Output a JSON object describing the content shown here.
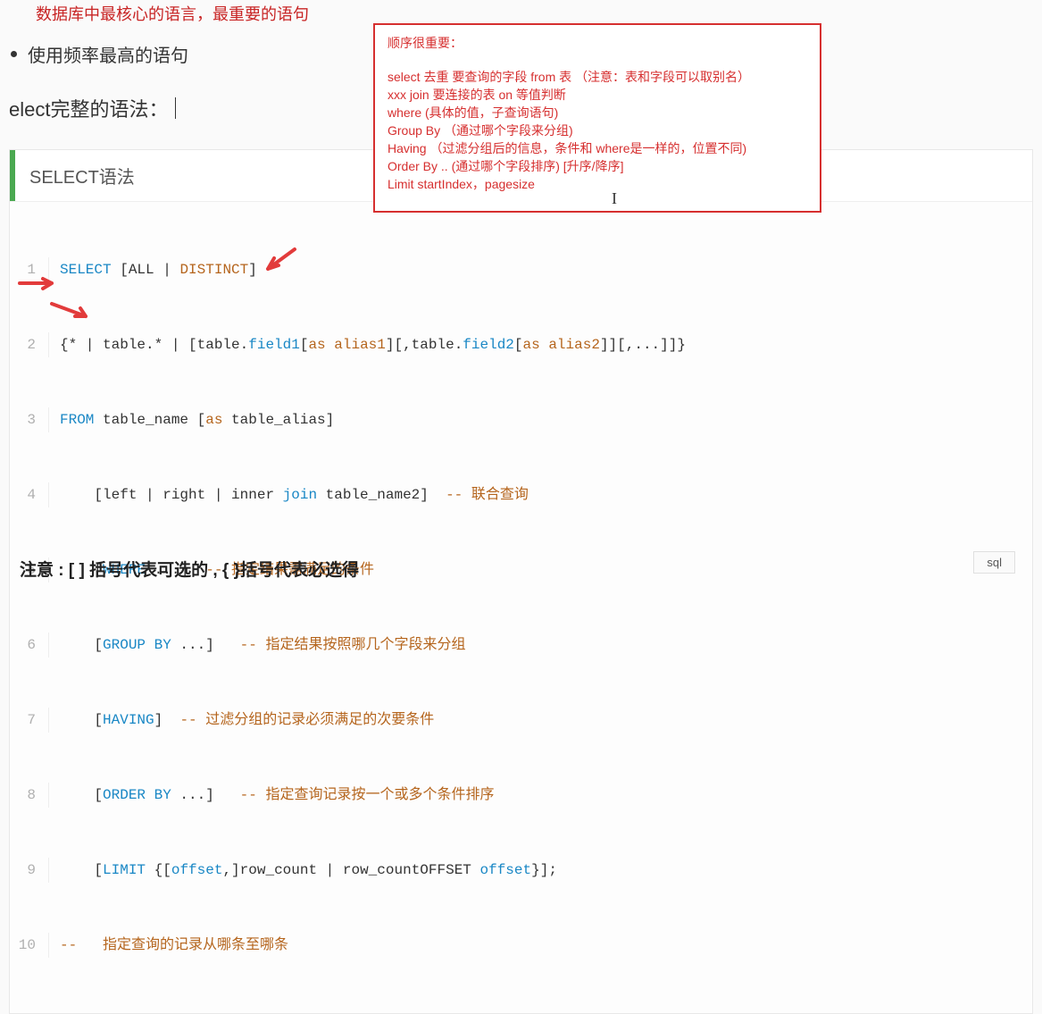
{
  "header": {
    "partial_red": "数据库中最核心的语言，最重要的语句",
    "bullet": "使用频率最高的语句",
    "syntax_heading": "elect完整的语法："
  },
  "red_note": {
    "title": "顺序很重要：",
    "lines": [
      "select 去重 要查询的字段 from 表   （注意：表和字段可以取别名）",
      "xxx join 要连接的表  on  等值判断",
      "where (具体的值，子查询语句)",
      "Group By  （通过哪个字段来分组)",
      "Having  （过滤分组后的信息，条件和 where是一样的，位置不同)",
      "Order By ..  (通过哪个字段排序)   [升序/降序]",
      "Limit  startIndex，pagesize"
    ]
  },
  "card": {
    "title": "SELECT语法",
    "lang_label": "sql"
  },
  "code": {
    "rows": [
      {
        "n": "1"
      },
      {
        "n": "2"
      },
      {
        "n": "3"
      },
      {
        "n": "4"
      },
      {
        "n": "5"
      },
      {
        "n": "6"
      },
      {
        "n": "7"
      },
      {
        "n": "8"
      },
      {
        "n": "9"
      },
      {
        "n": "10"
      }
    ],
    "l1": {
      "select": "SELECT ",
      "all": "[ALL | ",
      "distinct": "DISTINCT",
      "close": "]"
    },
    "l2": {
      "a": "{* | table.* | [table.",
      "field1": "field1",
      "b": "[",
      "as1": "as alias1",
      "c": "][,table.",
      "field2": "field2",
      "d": "[",
      "as2": "as alias2",
      "e": "]][,...]]}"
    },
    "l3": {
      "from": "FROM ",
      "name": "table_name [",
      "askw": "as",
      "alias": " table_alias]"
    },
    "l4": {
      "a": "    [left | right | inner ",
      "join": "join",
      "b": " table_name2]  ",
      "c": "-- 联合查询"
    },
    "l5": {
      "a": "    [",
      "where": "WHERE",
      "b": " ...]  ",
      "c": "-- 指定结果需满足的条件"
    },
    "l6": {
      "a": "    [",
      "grp": "GROUP BY",
      "b": " ...]   ",
      "c": "-- 指定结果按照哪几个字段来分组"
    },
    "l7": {
      "a": "    [",
      "hv": "HAVING",
      "b": "]  ",
      "c": "-- 过滤分组的记录必须满足的次要条件"
    },
    "l8": {
      "a": "    [",
      "ord": "ORDER BY",
      "b": " ...]   ",
      "c": "-- 指定查询记录按一个或多个条件排序"
    },
    "l9": {
      "a": "    [",
      "lim": "LIMIT",
      "b": " {[",
      "off": "offset",
      "c": ",]row_count | row_countOFFSET ",
      "off2": "offset",
      "d": "}];"
    },
    "l10": {
      "a": "--   指定查询的记录从哪条至哪条"
    }
  },
  "footer": {
    "note": "注意 : [ ] 括号代表可选的 , { }括号代表必选得"
  }
}
